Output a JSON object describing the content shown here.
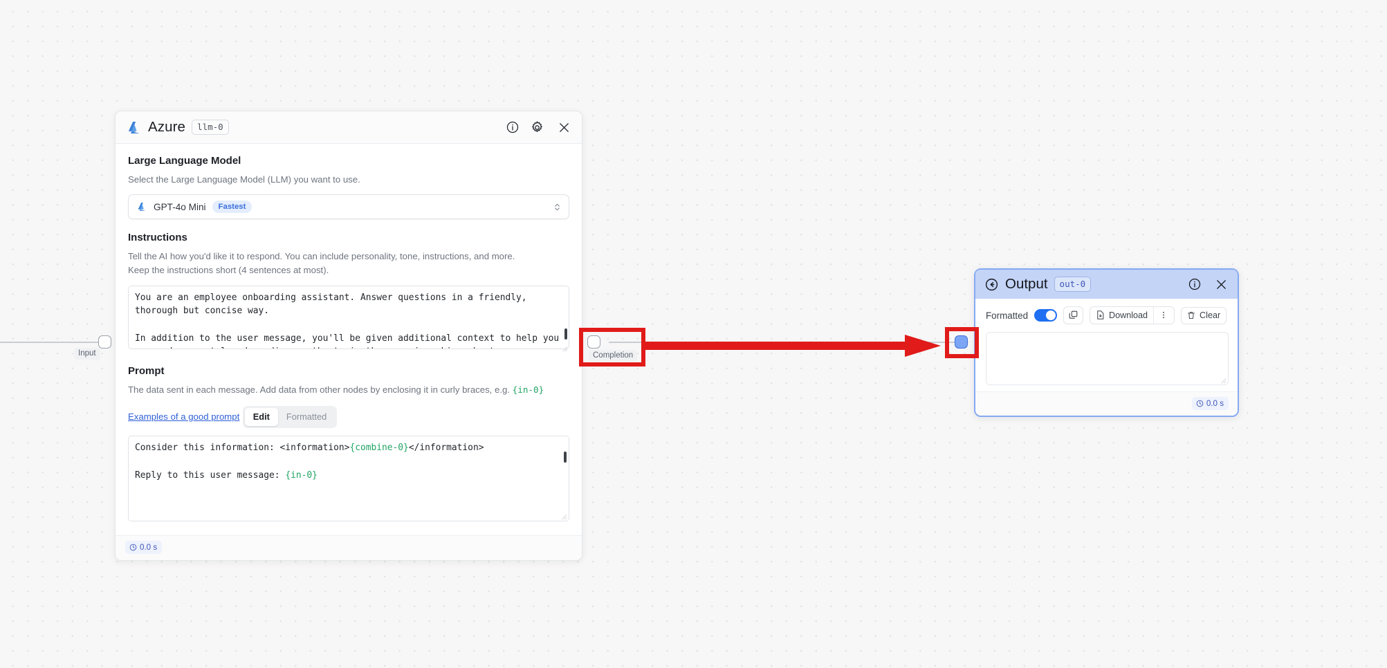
{
  "canvas": {
    "background_color": "#f7f7f7",
    "dot_color": "#e2e2e2"
  },
  "annotation": {
    "color": "#e01b19",
    "arrow_direction": "right",
    "description": "red arrow from Completion output port to Output node input port"
  },
  "edges": {
    "input_port": {
      "label": "Input"
    },
    "completion_port": {
      "label": "Completion"
    }
  },
  "llm_node": {
    "title": "Azure",
    "id_badge": "llm-0",
    "icon": "azure-logo-icon",
    "header_icons": [
      "info-icon",
      "gear-icon",
      "close-icon"
    ],
    "model_section": {
      "title": "Large Language Model",
      "description": "Select the Large Language Model (LLM) you want to use.",
      "selected_model": "GPT-4o Mini",
      "selected_model_badge": "Fastest",
      "badge_color": "#3b6fdc"
    },
    "instructions_section": {
      "title": "Instructions",
      "description_line1": "Tell the AI how you'd like it to respond. You can include personality, tone, instructions, and more.",
      "description_line2": "Keep the instructions short (4 sentences at most).",
      "value": "You are an employee onboarding assistant. Answer questions in a friendly, thorough but concise way.\n\nIn addition to the user message, you'll be given additional context to help you respond accurately, depending on the topic the user is asking about.\n\nWhen you don't have enough information to provide an answer, you must not"
    },
    "prompt_section": {
      "title": "Prompt",
      "description": "The data sent in each message. Add data from other nodes by enclosing it in curly braces, e.g. ",
      "description_token": "{in-0}",
      "link": "Examples of a good prompt",
      "tabs": [
        {
          "label": "Edit",
          "active": true
        },
        {
          "label": "Formatted",
          "active": false
        }
      ],
      "value_line1_pre": "Consider this information: <information>",
      "value_line1_token": "{combine-0}",
      "value_line1_post": "</information>",
      "value_line2_pre": "Reply to this user message: ",
      "value_line2_token": "{in-0}",
      "token_color": "#1fa463"
    },
    "footer": {
      "timer": "0.0 s"
    }
  },
  "output_node": {
    "title": "Output",
    "id_badge": "out-0",
    "back_icon": "back-arrow-icon",
    "header_icons": [
      "info-icon",
      "close-icon"
    ],
    "header_color": "#c3d4f7",
    "toolbar": {
      "formatted_label": "Formatted",
      "formatted_on": true,
      "toggle_color": "#1e6ff2",
      "copy_label": "",
      "download_label": "Download",
      "more_label": "",
      "clear_label": "Clear"
    },
    "content": "",
    "footer": {
      "timer": "0.0 s"
    }
  }
}
